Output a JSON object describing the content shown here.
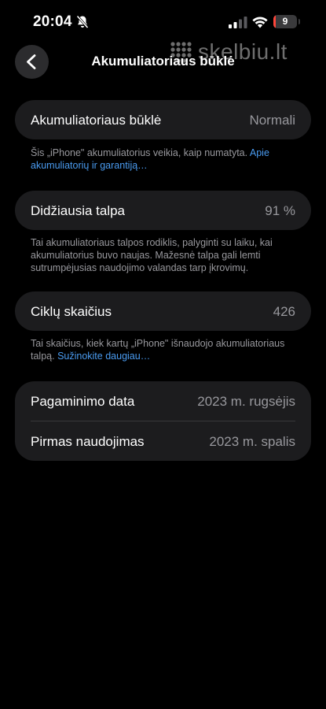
{
  "status_bar": {
    "time": "20:04",
    "silent_icon": "bell-slash-icon",
    "signal_icon": "cellular-signal-icon",
    "wifi_icon": "wifi-icon",
    "battery_level": "9",
    "battery_color": "#ff453a"
  },
  "watermark": {
    "text": "skelbiu.lt"
  },
  "nav": {
    "back_icon": "chevron-left-icon",
    "title": "Akumuliatoriaus būklė"
  },
  "battery_health": {
    "label": "Akumuliatoriaus būklė",
    "value": "Normali",
    "note": "Šis „iPhone\" akumuliatorius veikia, kaip numatyta. ",
    "note_link": "Apie akumuliatorių ir garantiją…"
  },
  "max_capacity": {
    "label": "Didžiausia talpa",
    "value": "91 %",
    "note": "Tai akumuliatoriaus talpos rodiklis, palyginti su laiku, kai akumuliatorius buvo naujas. Mažesnė talpa gali lemti sutrumpėjusias naudojimo valandas tarp įkrovimų."
  },
  "cycle_count": {
    "label": "Ciklų skaičius",
    "value": "426",
    "note": "Tai skaičius, kiek kartų „iPhone\" išnaudojo akumuliatoriaus talpą. ",
    "note_link": "Sužinokite daugiau…"
  },
  "dates": {
    "manufacture_label": "Pagaminimo data",
    "manufacture_value": "2023 m. rugsėjis",
    "first_use_label": "Pirmas naudojimas",
    "first_use_value": "2023 m. spalis"
  },
  "colors": {
    "background": "#000000",
    "card": "#1c1c1e",
    "secondary_text": "#98989d",
    "link": "#4a9bf0"
  }
}
